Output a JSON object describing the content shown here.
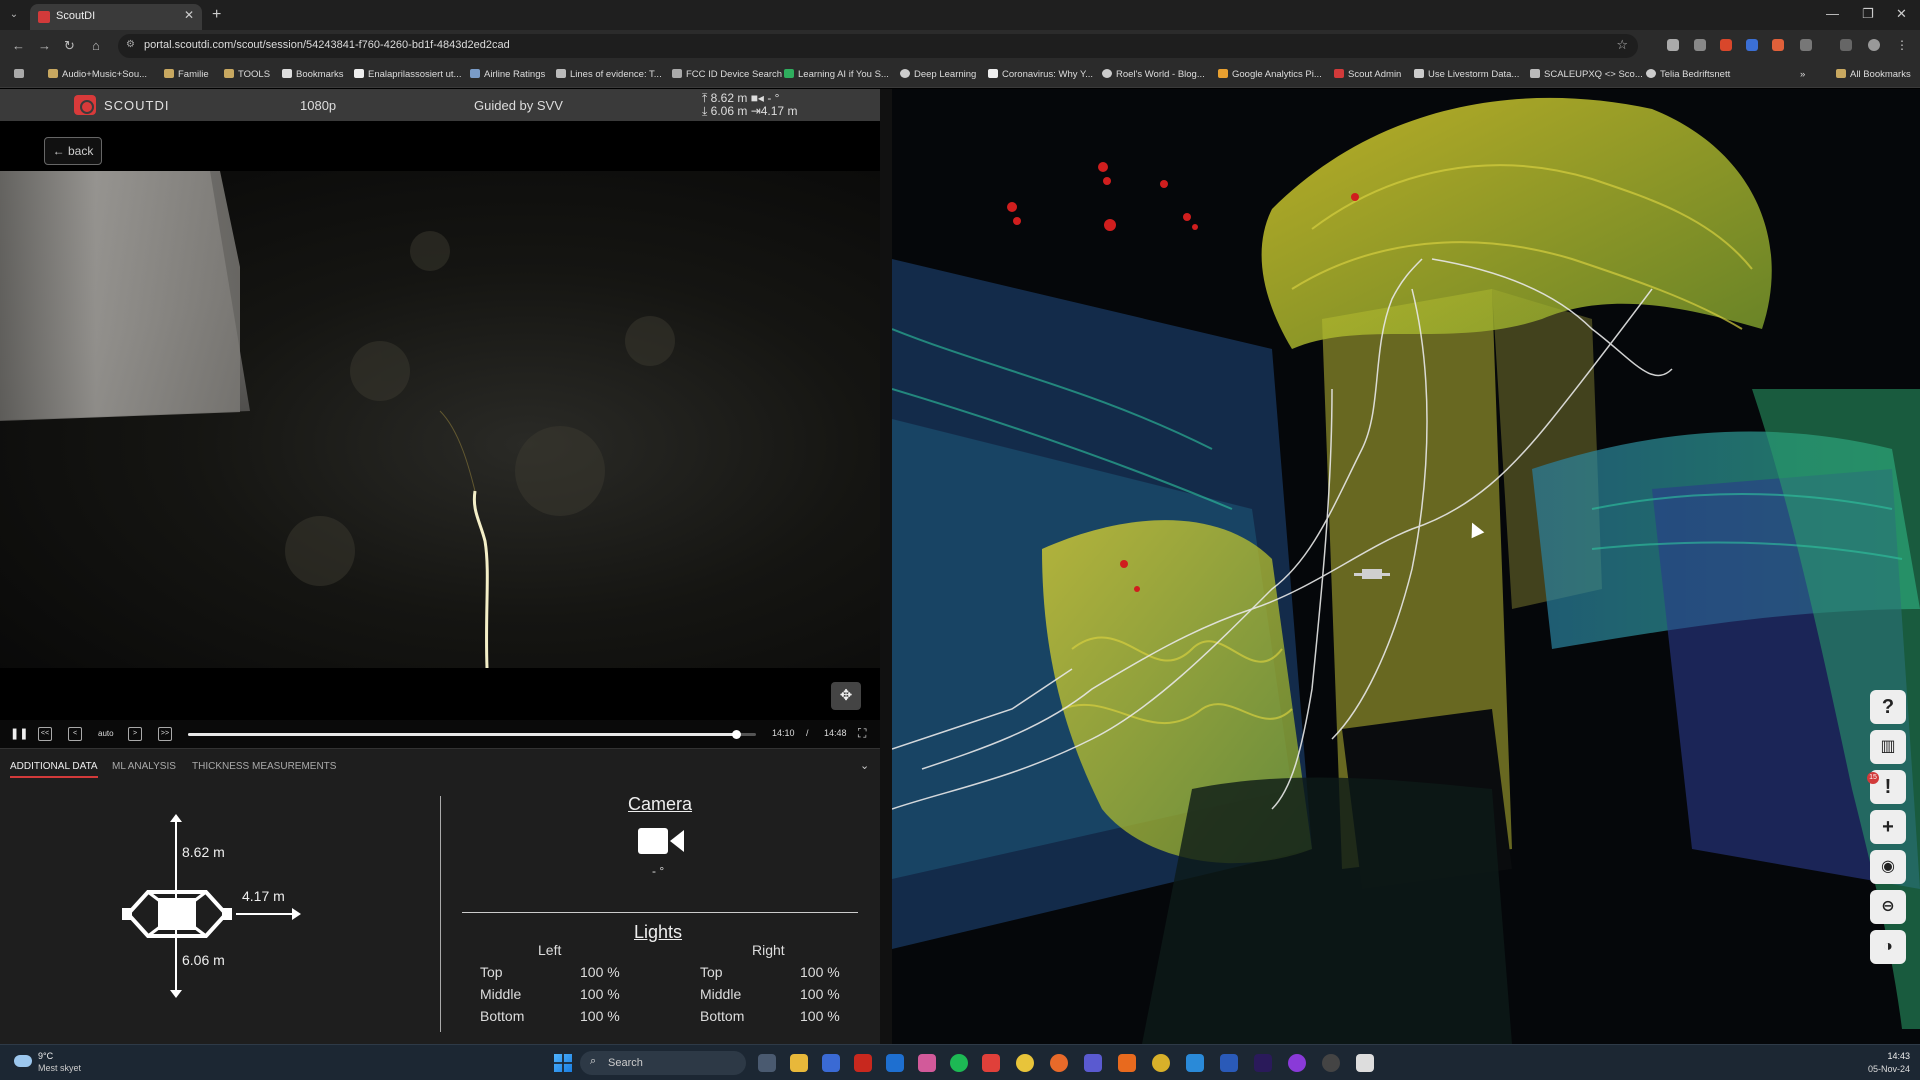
{
  "browser": {
    "tab_title": "ScoutDI",
    "url": "portal.scoutdi.com/scout/session/54243841-f760-4260-bd1f-4843d2ed2cad",
    "bookmarks": [
      "Audio+Music+Sou...",
      "Familie",
      "TOOLS",
      "Bookmarks",
      "Enalaprilassosiert ut...",
      "Airline Ratings",
      "Lines of evidence: T...",
      "FCC ID Device Search",
      "Learning AI if You S...",
      "Deep Learning",
      "Coronavirus: Why Y...",
      "Roel's World - Blog...",
      "Google Analytics Pi...",
      "Scout Admin",
      "Use Livestorm Data...",
      "SCALEUPXQ <> Sco...",
      "Telia Bedriftsnett"
    ],
    "all_bookmarks": "All Bookmarks"
  },
  "app": {
    "brand": "SCOUTDI",
    "resolution": "1080p",
    "guided": "Guided by SVV",
    "dist_up": "8.62 m",
    "dist_down": "6.06 m",
    "dist_right": "4.17 m",
    "cam_deg": "- °",
    "back": "back"
  },
  "player": {
    "auto": "auto",
    "current": "14:10",
    "sep": "/",
    "total": "14:48",
    "progress": 0.964
  },
  "tabs": [
    "ADDITIONAL DATA",
    "ML ANALYSIS",
    "THICKNESS MEASUREMENTS"
  ],
  "distances": {
    "up": "8.62 m",
    "right": "4.17 m",
    "down": "6.06 m"
  },
  "camera": {
    "title": "Camera",
    "angle": "- °"
  },
  "lights": {
    "title": "Lights",
    "left_header": "Left",
    "right_header": "Right",
    "rows": [
      {
        "label": "Top",
        "left": "100 %",
        "rlabel": "Top",
        "right": "100 %"
      },
      {
        "label": "Middle",
        "left": "100 %",
        "rlabel": "Middle",
        "right": "100 %"
      },
      {
        "label": "Bottom",
        "left": "100 %",
        "rlabel": "Bottom",
        "right": "100 %"
      }
    ]
  },
  "side_buttons": [
    {
      "name": "help-icon",
      "glyph": "?"
    },
    {
      "name": "map-icon",
      "glyph": "▥"
    },
    {
      "name": "alert-icon",
      "glyph": "!"
    },
    {
      "name": "plus-icon",
      "glyph": "+"
    },
    {
      "name": "eye-icon",
      "glyph": "◉"
    },
    {
      "name": "minus-circle-icon",
      "glyph": "⊖"
    },
    {
      "name": "toggle-icon",
      "glyph": "◑"
    }
  ],
  "alert_badge": "15",
  "taskbar": {
    "temp": "9°C",
    "weather": "Mest skyet",
    "search": "Search",
    "time": "14:43",
    "date": "05-Nov-24"
  },
  "colors": {
    "accent": "#d23a3a",
    "cloud_yellow": "#d8cc2a",
    "cloud_green": "#3fae6a",
    "cloud_cyan": "#1f9aa8",
    "cloud_blue": "#3a4fa0"
  }
}
